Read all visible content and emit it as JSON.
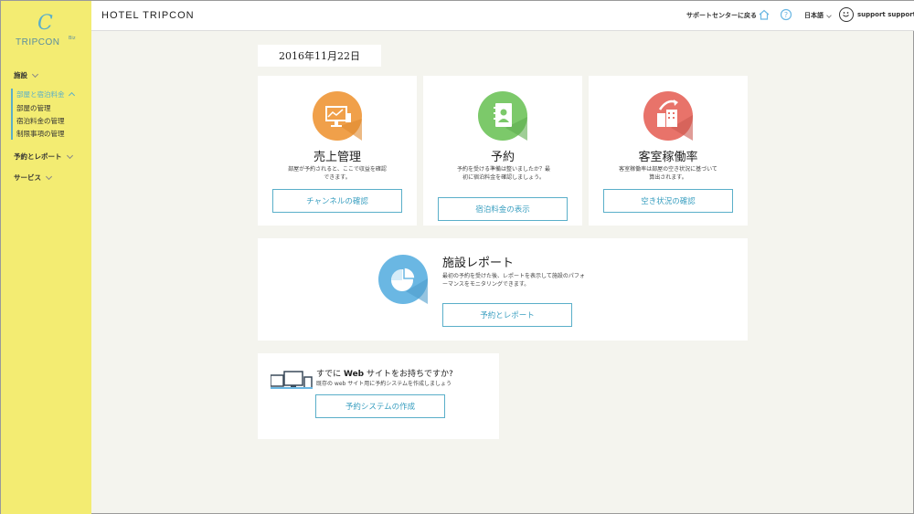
{
  "logo": {
    "mark": "C",
    "text": "TRIPCON",
    "sup": "Biz"
  },
  "sidebar": {
    "facility": "施設",
    "rooms_rates": "部屋と宿泊料金",
    "sub_items": [
      "部屋の管理",
      "宿泊料金の管理",
      "制限事項の管理"
    ],
    "reservations": "予約とレポート",
    "services": "サービス"
  },
  "header": {
    "hotel_name": "HOTEL TRIPCON",
    "support_center": "サポートセンターに戻る",
    "language": "日本語",
    "user": "support support"
  },
  "date": "2016年11月22日",
  "cards": {
    "sales": {
      "title": "売上管理",
      "desc": "部屋が予約されると、ここで収益を確認できます。",
      "button": "チャンネルの確認",
      "color": "#f0a04a"
    },
    "booking": {
      "title": "予約",
      "desc": "予約を受ける準備は整いましたか？最初に宿泊料金を確認しましょう。",
      "button": "宿泊料金の表示",
      "color": "#7cc96a"
    },
    "occupancy": {
      "title": "客室稼働率",
      "desc": "客室稼働率は部屋の空き状況に基づいて算出されます。",
      "button": "空き状況の確認",
      "color": "#e8736a"
    },
    "report": {
      "title": "施設レポート",
      "desc": "最初の予約を受けた後、レポートを表示して施設のパフォーマンスをモニタリングできます。",
      "button": "予約とレポート",
      "color": "#6ab7e3"
    },
    "website": {
      "title_pre": "すでに",
      "title_bold": "Web",
      "title_post": "サイトをお持ちですか?",
      "desc": "既存の web サイト用に予約システムを作成しましょう",
      "button": "予約システムの作成"
    }
  }
}
